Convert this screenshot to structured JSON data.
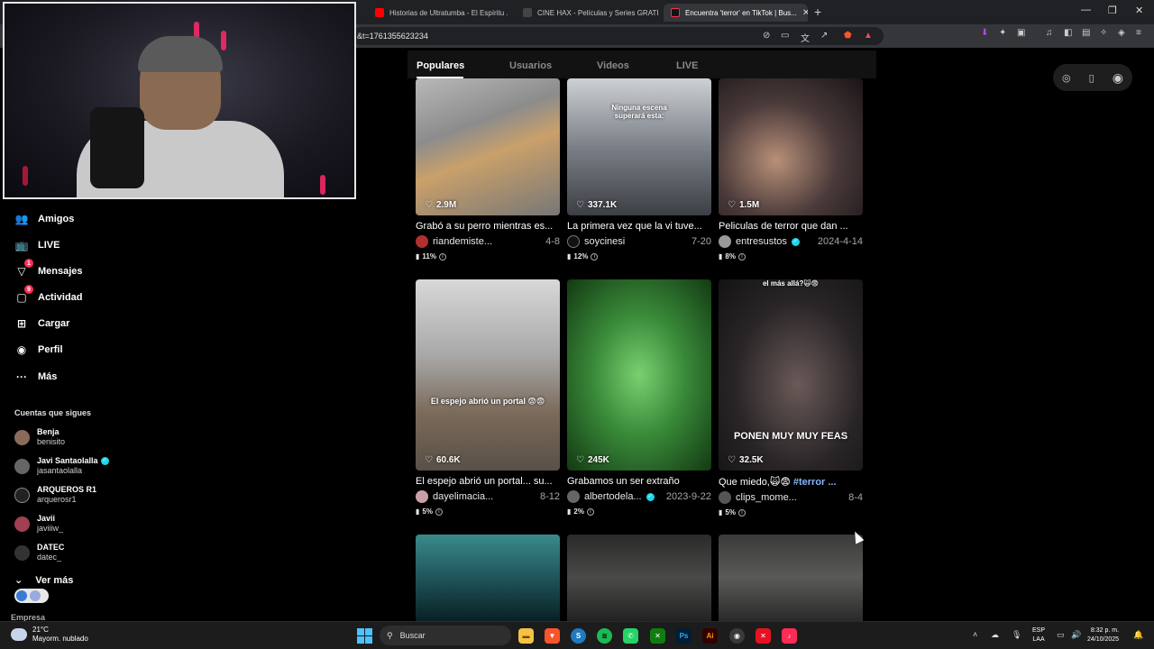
{
  "browser": {
    "tabs": [
      {
        "label": "Historias de Ultratumba - El Espíritu ...",
        "active": false
      },
      {
        "label": "CINE HAX - Películas y Series GRATIS",
        "active": false
      },
      {
        "label": "Encuentra 'terror' en TikTok | Bus...",
        "active": true
      }
    ],
    "new_tab": "+",
    "url": "&t=1761355623234"
  },
  "sidebar": {
    "nav": [
      {
        "label": "Amigos",
        "icon": "friends-icon",
        "badge": ""
      },
      {
        "label": "LIVE",
        "icon": "live-icon",
        "badge": ""
      },
      {
        "label": "Mensajes",
        "icon": "messages-icon",
        "badge": "1"
      },
      {
        "label": "Actividad",
        "icon": "activity-icon",
        "badge": "9"
      },
      {
        "label": "Cargar",
        "icon": "upload-icon",
        "badge": ""
      },
      {
        "label": "Perfil",
        "icon": "profile-icon",
        "badge": ""
      },
      {
        "label": "Más",
        "icon": "more-icon",
        "badge": ""
      }
    ],
    "following_title": "Cuentas que sigues",
    "following": [
      {
        "name": "Benja",
        "handle": "benisito",
        "verified": false
      },
      {
        "name": "Javi Santaolalla",
        "handle": "jasantaolalla",
        "verified": true
      },
      {
        "name": "ARQUEROS R1",
        "handle": "arquerosr1",
        "verified": false
      },
      {
        "name": "Javii",
        "handle": "javiiiw_",
        "verified": false
      },
      {
        "name": "DATEC",
        "handle": "datec_",
        "verified": false
      }
    ],
    "see_more": "Ver más",
    "company": "Empresa"
  },
  "search_tabs": [
    "Populares",
    "Usuarios",
    "Videos",
    "LIVE"
  ],
  "videos": [
    {
      "likes": "2.9M",
      "desc": "Grabó a su perro mientras es...",
      "user": "riandemiste...",
      "date": "4-8",
      "stat": "11%",
      "overlay": "",
      "verified": false
    },
    {
      "likes": "337.1K",
      "desc": "La primera vez que la vi tuve...",
      "user": "soycinesi",
      "date": "7-20",
      "stat": "12%",
      "overlay": "Ninguna escena superará esta:",
      "verified": false
    },
    {
      "likes": "1.5M",
      "desc": "Peliculas de terror que dan ...",
      "user": "entresustos",
      "date": "2024-4-14",
      "stat": "8%",
      "overlay": "",
      "verified": true
    },
    {
      "likes": "60.6K",
      "desc": "El espejo abrió un portal... su...",
      "user": "dayelimacia...",
      "date": "8-12",
      "stat": "5%",
      "overlay": "El espejo abrió un portal 😨😨",
      "verified": false
    },
    {
      "likes": "245K",
      "desc": "Grabamos un ser extraño",
      "user": "albertodela...",
      "date": "2023-9-22",
      "stat": "2%",
      "overlay": "",
      "verified": true
    },
    {
      "likes": "32.5K",
      "desc": "Que miedo,🙀😨 ",
      "tag": "#terror ...",
      "user": "clips_mome...",
      "date": "8-4",
      "stat": "5%",
      "overlay": "PONEN MUY MUY FEAS",
      "overlay_top": "el más allá?🙀😨",
      "verified": false
    }
  ],
  "taskbar": {
    "weather_temp": "21°C",
    "weather_desc": "Mayorm. nublado",
    "search": "Buscar",
    "lang_top": "ESP",
    "lang_bottom": "LAA",
    "time": "8:32 p. m.",
    "date": "24/10/2025"
  },
  "colors": {
    "accent": "#fe2c55",
    "verified": "#20d5ec",
    "hashtag": "#8ab4f8"
  }
}
